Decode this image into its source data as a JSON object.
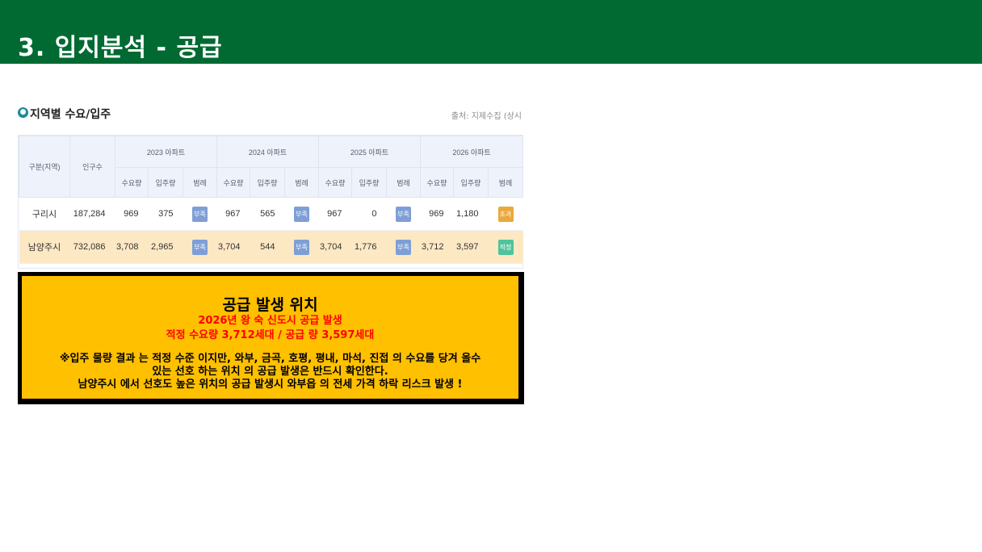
{
  "slide": {
    "title": "3. 입지분석 - 공급"
  },
  "section": {
    "title": "지역별 수요/입주",
    "source": "출처: 지제수집 (상시"
  },
  "table": {
    "header_region": "구분(지역)",
    "header_population": "인구수",
    "years": [
      "2023 아파트",
      "2024 아파트",
      "2025 아파트",
      "2026 아파트"
    ],
    "subheaders": [
      "수요량",
      "입주량",
      "범례"
    ],
    "rows": [
      {
        "region": "구리시",
        "population": "187,284",
        "cells": [
          {
            "demand": "969",
            "supply": "375",
            "legend": "부족"
          },
          {
            "demand": "967",
            "supply": "565",
            "legend": "부족"
          },
          {
            "demand": "967",
            "supply": "0",
            "legend": "부족"
          },
          {
            "demand": "969",
            "supply": "1,180",
            "legend": "초과"
          }
        ]
      },
      {
        "region": "남양주시",
        "population": "732,086",
        "cells": [
          {
            "demand": "3,708",
            "supply": "2,965",
            "legend": "부족"
          },
          {
            "demand": "3,704",
            "supply": "544",
            "legend": "부족"
          },
          {
            "demand": "3,704",
            "supply": "1,776",
            "legend": "부족"
          },
          {
            "demand": "3,712",
            "supply": "3,597",
            "legend": "적정"
          }
        ]
      }
    ],
    "legend_colors": {
      "부족": "#7e9fd6",
      "초과": "#e9a93b",
      "적정": "#4fc49a"
    }
  },
  "callout": {
    "title": "공급 발생 위치",
    "line1": "2026년 왕 숙 신도시 공급 발생",
    "line2": "적정 수요량 3,712세대 / 공급 량 3,597세대",
    "body1": "※입주 물량 결과 는 적정 수준 이지만, 와부, 금곡, 호평, 평내, 마석, 진접 의 수요를 당겨 올수",
    "body2": "있는 선호 하는 위치 의 공급 발생은 반드시 확인한다.",
    "body3": "남양주시 에서 선호도 높은 위치의 공급 발생시 와부읍 의 전세 가격 하락 리스크 발생 !"
  },
  "colors": {
    "header_bg": "#006a32",
    "callout_bg": "#ffc000",
    "callout_red": "#ff0000"
  }
}
